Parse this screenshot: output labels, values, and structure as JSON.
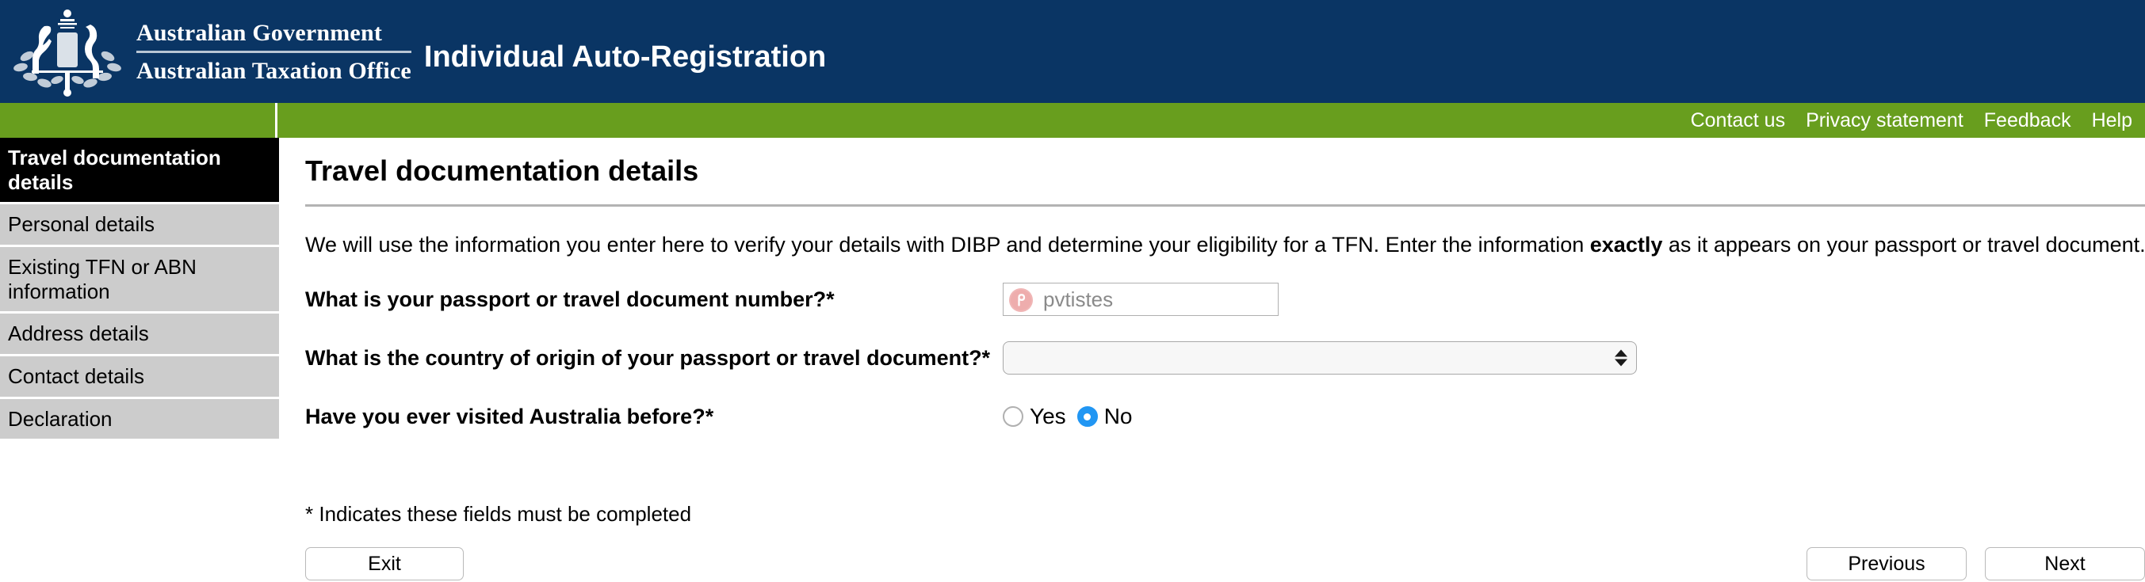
{
  "header": {
    "gov_line1": "Australian Government",
    "gov_line2": "Australian Taxation Office",
    "app_title": "Individual Auto-Registration",
    "crest_icon": "australian-coat-of-arms",
    "background_color": "#0a3564"
  },
  "navbar": {
    "background_color": "#689e1e",
    "links": [
      {
        "label": "Contact us"
      },
      {
        "label": "Privacy statement"
      },
      {
        "label": "Feedback"
      },
      {
        "label": "Help"
      }
    ]
  },
  "sidebar": {
    "items": [
      {
        "label": "Travel documentation details",
        "active": true
      },
      {
        "label": "Personal details",
        "active": false
      },
      {
        "label": "Existing TFN or ABN information",
        "active": false
      },
      {
        "label": "Address details",
        "active": false
      },
      {
        "label": "Contact details",
        "active": false
      },
      {
        "label": "Declaration",
        "active": false
      }
    ],
    "active_background_color": "#000000",
    "item_background_color": "#cccccc"
  },
  "main": {
    "page_title": "Travel documentation details",
    "intro_part1": "We will use the information you enter here to verify your details with DIBP and determine your eligibility for a TFN. Enter the information ",
    "intro_emphasis": "exactly",
    "intro_part2": " as it appears on your passport or travel document.",
    "fields": {
      "passport_number": {
        "label": "What is your passport or travel document number?*",
        "value": "pvtistes",
        "placeholder": "",
        "badge_icon": "pvtistes-logo-icon",
        "badge_color": "#f0b6b6"
      },
      "country_of_origin": {
        "label": "What is the country of origin of your passport or travel document?*",
        "selected": "",
        "options": [
          ""
        ]
      },
      "visited_australia": {
        "label": "Have you ever visited Australia before?*",
        "options": [
          {
            "label": "Yes",
            "selected": false
          },
          {
            "label": "No",
            "selected": true
          }
        ],
        "selected_color": "#2196f3"
      }
    },
    "required_note": "* Indicates these fields must be completed",
    "buttons": {
      "exit": "Exit",
      "previous": "Previous",
      "next": "Next"
    }
  }
}
